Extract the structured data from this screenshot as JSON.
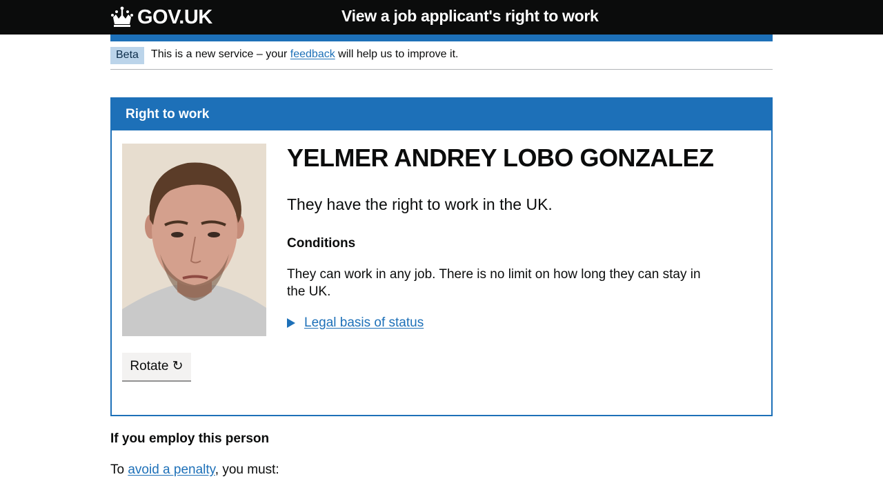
{
  "header": {
    "logo_text": "GOV.UK",
    "service_name": "View a job applicant's right to work"
  },
  "phase_banner": {
    "tag": "Beta",
    "text_before": "This is a new service – your ",
    "link": "feedback",
    "text_after": " will help us to improve it."
  },
  "panel": {
    "title": "Right to work",
    "person_name": "YELMER ANDREY LOBO GONZALEZ",
    "status": "They have the right to work in the UK.",
    "conditions_heading": "Conditions",
    "conditions_text": "They can work in any job. There is no limit on how long they can stay in the UK.",
    "details_link": "Legal basis of status",
    "rotate_button": "Rotate ↻"
  },
  "employ": {
    "heading": "If you employ this person",
    "text_before": "To ",
    "link": "avoid a penalty",
    "text_after": ", you must:"
  },
  "colors": {
    "brand_blue": "#1d70b8",
    "header_black": "#0b0c0c",
    "beta_tag_bg": "#bbd4ea"
  }
}
